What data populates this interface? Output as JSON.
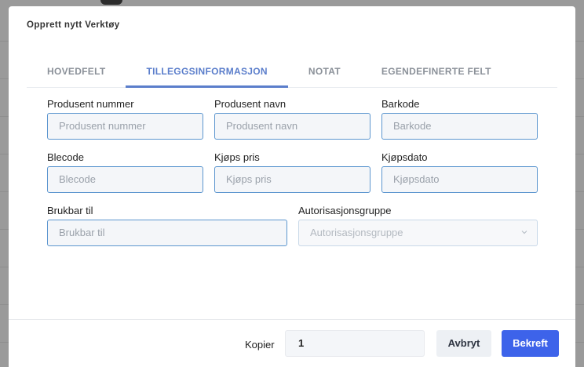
{
  "dialog": {
    "title": "Opprett nytt Verktøy"
  },
  "tabs": [
    {
      "label": "HOVEDFELT",
      "active": false
    },
    {
      "label": "TILLEGGSINFORMASJON",
      "active": true
    },
    {
      "label": "NOTAT",
      "active": false
    },
    {
      "label": "EGENDEFINERTE FELT",
      "active": false
    }
  ],
  "fields": {
    "produsent_nummer": {
      "label": "Produsent nummer",
      "placeholder": "Produsent nummer",
      "value": ""
    },
    "produsent_navn": {
      "label": "Produsent navn",
      "placeholder": "Produsent navn",
      "value": ""
    },
    "barkode": {
      "label": "Barkode",
      "placeholder": "Barkode",
      "value": ""
    },
    "blecode": {
      "label": "Blecode",
      "placeholder": "Blecode",
      "value": ""
    },
    "kjops_pris": {
      "label": "Kjøps pris",
      "placeholder": "Kjøps pris",
      "value": ""
    },
    "kjopsdato": {
      "label": "Kjøpsdato",
      "placeholder": "Kjøpsdato",
      "value": ""
    },
    "brukbar_til": {
      "label": "Brukbar til",
      "placeholder": "Brukbar til",
      "value": ""
    },
    "autorisasjonsgruppe": {
      "label": "Autorisasjonsgruppe",
      "placeholder": "Autorisasjonsgruppe",
      "selected": "",
      "icon": "chevron-down-icon"
    }
  },
  "footer": {
    "kopier_label": "Kopier",
    "kopier_value": "1",
    "cancel_label": "Avbryt",
    "confirm_label": "Bekreft"
  },
  "colors": {
    "accent": "#5b7ecb",
    "primary_button": "#3d63ea",
    "input_border": "#5c96cf"
  }
}
